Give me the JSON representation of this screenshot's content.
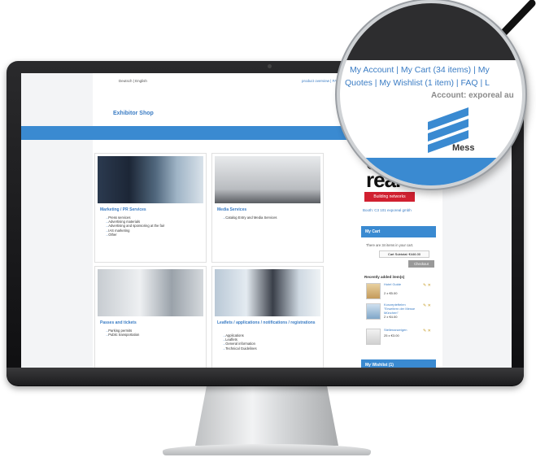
{
  "header": {
    "language_switch": "Deutsch | English",
    "top_links": "product overview | FAQ",
    "shop_title": "Exhibitor Shop"
  },
  "magnifier": {
    "line1": "My Account  |  My Cart (34 items)  |  My",
    "line2": "Quotes  |  My Wishlist (1 item)  |  FAQ  |  L",
    "account": "Account: exporeal au",
    "logo_text": "Mess"
  },
  "categories": [
    {
      "title": "Marketing / PR Services",
      "items": [
        "Press services",
        "Advertising materials",
        "Advertising and sponsoring at the fair",
        "IAS marketing",
        "Other"
      ]
    },
    {
      "title": "Media Services",
      "items": [
        "Catalog Entry and Media Services"
      ]
    },
    {
      "title": "Passes and tickets",
      "items": [
        "Parking permits",
        "Public transportation"
      ]
    },
    {
      "title": "Leaflets / applications / notifications / registrations",
      "items": [
        "Applications",
        "Leaflets",
        "General information",
        "Technical Guidelines"
      ]
    }
  ],
  "sidebar": {
    "logo_word1": "ex",
    "logo_word2": "real",
    "logo_band": "Building networks",
    "hall_info": "Booth: C3 101 exporeal gmbh",
    "cart_title": "My Cart",
    "cart_text": "There are 34 items in your cart.",
    "cart_subtotal": "Cart Subtotal: €446.00",
    "checkout_label": "Checkout",
    "recent_title": "Recently added item(s)",
    "recent_items": [
      {
        "name": "Hotel Guide",
        "price": "2 x €5.00"
      },
      {
        "name": "Konzepteftelen \"Erweitern der Messe München\"",
        "price": "2 x €4.00"
      },
      {
        "name": "Stellenanzeigen",
        "price": "25 x €3.00"
      }
    ],
    "wishlist_title": "My Wishlist (1)"
  },
  "colors": {
    "accent": "#3a8ad1",
    "link": "#3a7cc4",
    "brand_red": "#d12030"
  }
}
